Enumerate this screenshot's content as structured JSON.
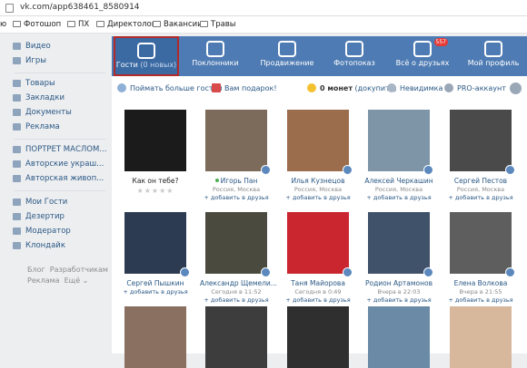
{
  "browser": {
    "url": "vk.com/app638461_8580914"
  },
  "bookmarks": [
    {
      "label": "Фотошоп"
    },
    {
      "label": "ПХ"
    },
    {
      "label": "Директологи"
    },
    {
      "label": "Вакансии"
    },
    {
      "label": "Травы"
    }
  ],
  "sidebar": {
    "items": [
      {
        "label": "Видео"
      },
      {
        "label": "Игры"
      },
      {
        "label": "Товары"
      },
      {
        "label": "Закладки"
      },
      {
        "label": "Документы"
      },
      {
        "label": "Реклама"
      },
      {
        "label": "ПОРТРЕТ МАСЛОМ..."
      },
      {
        "label": "Авторские украш..."
      },
      {
        "label": "Авторская живоп..."
      },
      {
        "label": "Мои Гости"
      },
      {
        "label": "Дезертир"
      },
      {
        "label": "Модератор"
      },
      {
        "label": "Клондайк"
      }
    ],
    "footer": {
      "blog": "Блог",
      "developers": "Разработчикам",
      "ads": "Реклама",
      "more": "Ещё ⌄"
    }
  },
  "nav": [
    {
      "label": "Гости",
      "sub": "(0 новых)"
    },
    {
      "label": "Поклонники"
    },
    {
      "label": "Продвижение"
    },
    {
      "label": "Фотопоказ"
    },
    {
      "label": "Всё о друзьях",
      "badge": "557"
    },
    {
      "label": "Мой профиль"
    }
  ],
  "toolbar": {
    "catch_guests": "Поймать больше гостей",
    "gift": "Вам подарок!",
    "coins": "0 монет",
    "topup": "(докупить)",
    "invisible": "Невидимка",
    "pro": "PRO-аккаунт"
  },
  "cards_row1": [
    {
      "name": "Как он тебе?",
      "stars": "★★★★★"
    },
    {
      "name": "Игорь Пан",
      "sub": "Россия, Москва",
      "add": "+ добавить в друзья"
    },
    {
      "name": "Илья Кузнецов",
      "sub": "Россия, Москва",
      "add": "+ добавить в друзья"
    },
    {
      "name": "Алексей Черкашин",
      "sub": "Россия, Москва",
      "add": "+ добавить в друзья"
    },
    {
      "name": "Сергей Пестов",
      "sub": "Россия, Москва",
      "add": "+ добавить в друзья"
    }
  ],
  "cards_row2": [
    {
      "name": "Сергей Пышкин",
      "add": "+ добавить в друзья"
    },
    {
      "name": "Александр Щемели...",
      "sub": "Сегодня в 11:52",
      "add": "+ добавить в друзья"
    },
    {
      "name": "Таня Майорова",
      "sub": "Сегодня в 0:49",
      "add": "+ добавить в друзья"
    },
    {
      "name": "Родион Артамонов",
      "sub": "Вчера в 22:03",
      "add": "+ добавить в друзья"
    },
    {
      "name": "Елена Волкова",
      "sub": "Вчера в 21:55",
      "add": "+ добавить в друзья"
    }
  ]
}
